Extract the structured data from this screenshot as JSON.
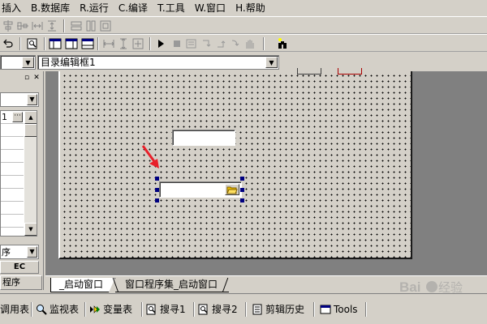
{
  "menu": {
    "items": [
      "插入",
      "B.数据库",
      "R.运行",
      "C.编译",
      "T.工具",
      "W.窗口",
      "H.帮助"
    ]
  },
  "combos": {
    "object_name": "",
    "event_name": "目录编辑框1"
  },
  "left_panel": {
    "property_rows": [
      "1",
      "",
      "",
      "",
      "",
      "",
      "",
      "",
      ""
    ],
    "prog_combo_text": "序",
    "ec_label": "EC",
    "program_tab": "程序"
  },
  "doc_tabs": {
    "active": "_启动窗口",
    "inactive": "窗口程序集_启动窗口"
  },
  "bottom_tabs": [
    {
      "label": "调用表",
      "icon": "call-table-icon"
    },
    {
      "label": "监视表",
      "icon": "magnifier-icon"
    },
    {
      "label": "变量表",
      "icon": "variable-table-icon"
    },
    {
      "label": "搜寻1",
      "icon": "search-result-icon"
    },
    {
      "label": "搜寻2",
      "icon": "search-result-icon"
    },
    {
      "label": "剪辑历史",
      "icon": "clip-history-icon"
    },
    {
      "label": "Tools",
      "icon": "tools-window-icon"
    }
  ],
  "colors": {
    "selection_handle": "#000080",
    "arrow": "#e8202a",
    "face": "#d4d0c8",
    "workspace": "#808080"
  }
}
